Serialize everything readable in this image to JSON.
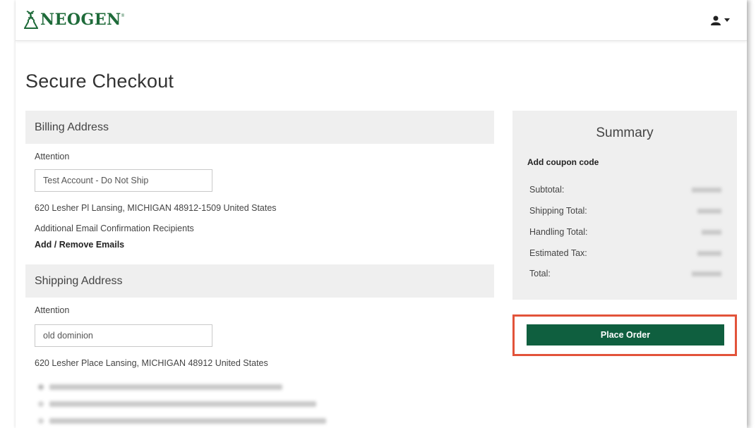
{
  "brand": {
    "name": "NEOGEN",
    "tm": "®"
  },
  "header": {
    "user_icon": "user-icon",
    "caret_icon": "caret-down-icon"
  },
  "page_title": "Secure Checkout",
  "billing": {
    "header": "Billing Address",
    "attention_label": "Attention",
    "attention_value": "Test Account - Do Not Ship",
    "address": "620 Lesher Pl Lansing, MICHIGAN 48912-1509 United States",
    "email_label": "Additional Email Confirmation Recipients",
    "email_link": "Add / Remove Emails"
  },
  "shipping": {
    "header": "Shipping Address",
    "attention_label": "Attention",
    "attention_value": "old dominion",
    "address": "620 Lesher Place Lansing, MICHIGAN 48912 United States"
  },
  "summary": {
    "title": "Summary",
    "coupon": "Add coupon code",
    "rows": [
      {
        "label": "Subtotal:"
      },
      {
        "label": "Shipping Total:"
      },
      {
        "label": "Handling Total:"
      },
      {
        "label": "Estimated Tax:"
      },
      {
        "label": "Total:"
      }
    ]
  },
  "place_order": "Place Order",
  "colors": {
    "brand_green": "#1f6b3a",
    "button_green": "#0f5f3f",
    "highlight": "#e2533a"
  }
}
